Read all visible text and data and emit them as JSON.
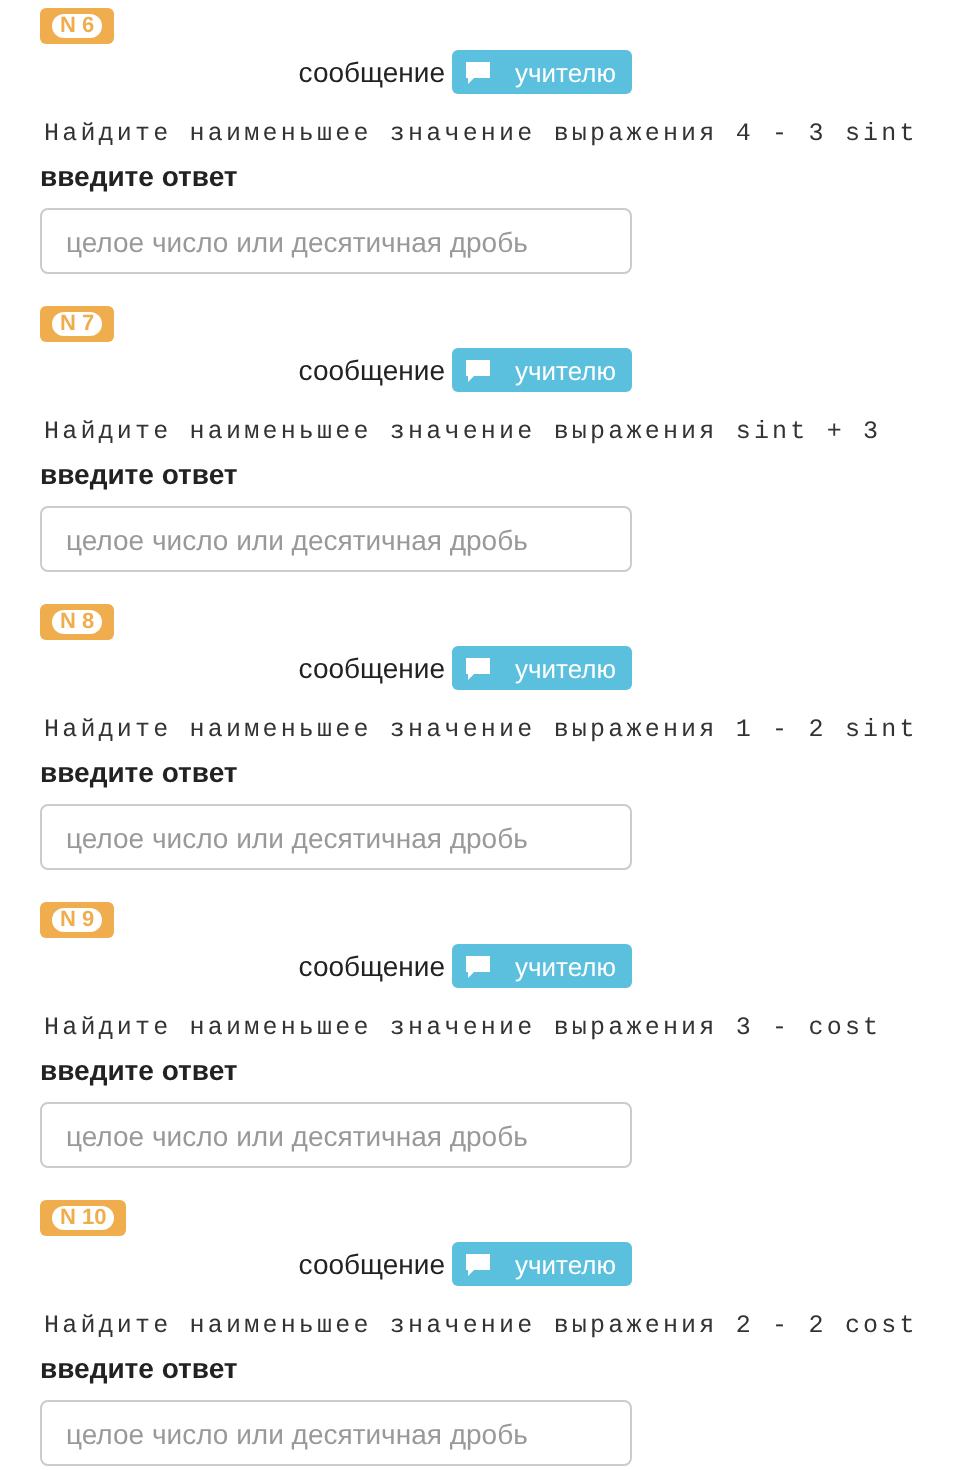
{
  "tasks": [
    {
      "number": "N 6",
      "message_label": "сообщение",
      "message_button": "учителю",
      "question": "Найдите наименьшее значение выражения 4 - 3 sint",
      "answer_label": "введите ответ",
      "placeholder": "целое число или десятичная дробь"
    },
    {
      "number": "N 7",
      "message_label": "сообщение",
      "message_button": "учителю",
      "question": "Найдите наименьшее значение выражения sint + 3",
      "answer_label": "введите ответ",
      "placeholder": "целое число или десятичная дробь"
    },
    {
      "number": "N 8",
      "message_label": "сообщение",
      "message_button": "учителю",
      "question": "Найдите наименьшее значение выражения 1 - 2 sint",
      "answer_label": "введите ответ",
      "placeholder": "целое число или десятичная дробь"
    },
    {
      "number": "N 9",
      "message_label": "сообщение",
      "message_button": "учителю",
      "question": "Найдите наименьшее значение выражения 3 - cost",
      "answer_label": "введите ответ",
      "placeholder": "целое число или десятичная дробь"
    },
    {
      "number": "N 10",
      "message_label": "сообщение",
      "message_button": "учителю",
      "question": "Найдите наименьшее значение выражения 2 - 2 cost",
      "answer_label": "введите ответ",
      "placeholder": "целое число или десятичная дробь"
    }
  ]
}
